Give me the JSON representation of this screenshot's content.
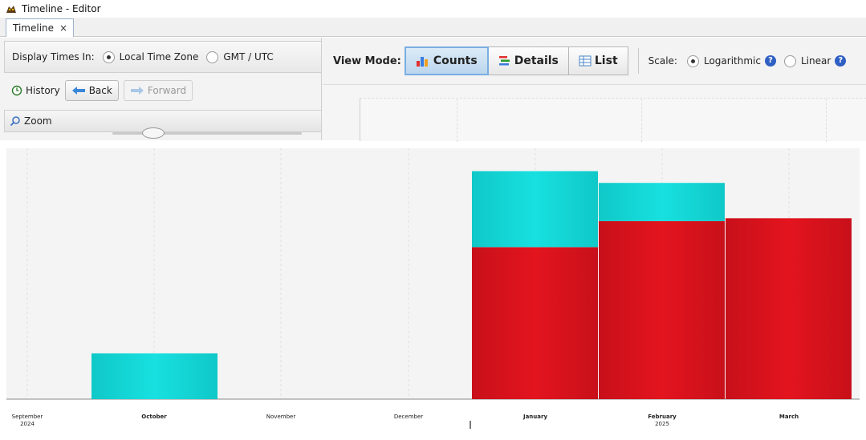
{
  "window": {
    "title": "Timeline - Editor"
  },
  "tabs": [
    {
      "label": "Timeline",
      "close_glyph": "×"
    }
  ],
  "time_zone": {
    "label": "Display Times In:",
    "options": [
      {
        "label": "Local Time Zone",
        "selected": true
      },
      {
        "label": "GMT / UTC",
        "selected": false
      }
    ]
  },
  "history": {
    "label": "History",
    "back_label": "Back",
    "forward_label": "Forward"
  },
  "zoom": {
    "label": "Zoom"
  },
  "view_mode": {
    "label": "View Mode:",
    "modes": [
      {
        "label": "Counts",
        "active": true,
        "icon": "bar-chart-icon"
      },
      {
        "label": "Details",
        "active": false,
        "icon": "details-icon"
      },
      {
        "label": "List",
        "active": false,
        "icon": "table-icon"
      }
    ]
  },
  "scale": {
    "label": "Scale:",
    "options": [
      {
        "label": "Logarithmic",
        "selected": true
      },
      {
        "label": "Linear",
        "selected": false
      }
    ],
    "help_glyph": "?"
  },
  "colors": {
    "series_a": "#e3141e",
    "series_b": "#18e0e0",
    "help": "#2f5fc3",
    "active_mode": "#7aaee0"
  },
  "chart_data": {
    "type": "bar",
    "stacked": true,
    "scale": "logarithmic",
    "categories": [
      "October",
      "January",
      "February",
      "March"
    ],
    "series": [
      {
        "color": "#e3141e",
        "values": [
          0,
          100,
          220,
          240
        ]
      },
      {
        "color": "#18e0e0",
        "values": [
          4,
          900,
          480,
          0
        ]
      }
    ],
    "ylim": [
      1,
      2000
    ],
    "grid": true,
    "x_ticks": [
      {
        "label": "September",
        "sublabel": "2024",
        "bold": false
      },
      {
        "label": "October",
        "sublabel": "",
        "bold": true
      },
      {
        "label": "November",
        "sublabel": "",
        "bold": false
      },
      {
        "label": "December",
        "sublabel": "",
        "bold": false
      },
      {
        "label": "January",
        "sublabel": "",
        "bold": true
      },
      {
        "label": "February",
        "sublabel": "2025",
        "bold": true
      },
      {
        "label": "March",
        "sublabel": "",
        "bold": true
      }
    ]
  }
}
